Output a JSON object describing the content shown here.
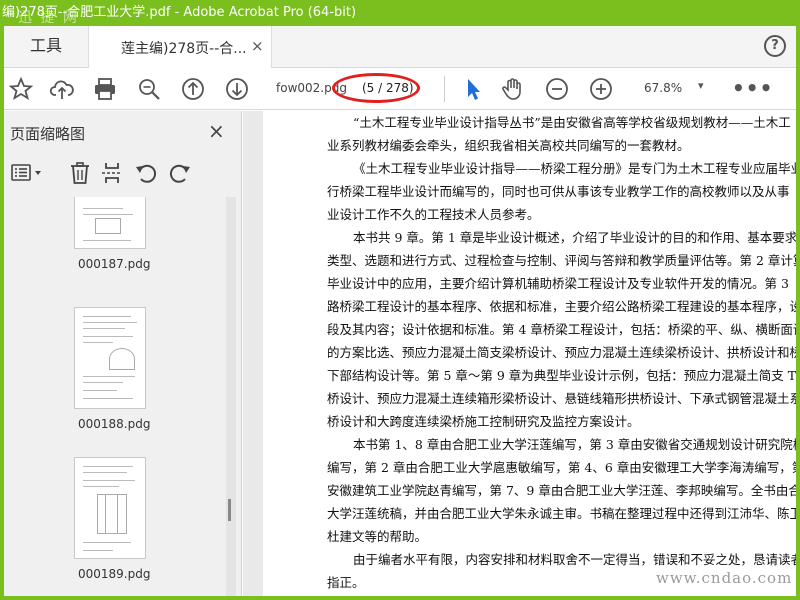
{
  "window": {
    "title": "编)278页--合肥工业大学.pdf - Adobe Acrobat Pro (64-bit)",
    "watermark": "迅 捷 网"
  },
  "tabs": {
    "tools_label": "工具",
    "doc_label": "莲主编)278页--合...",
    "close_symbol": "×",
    "help_symbol": "?"
  },
  "toolbar": {
    "filename": "fow002.pdg",
    "page_indicator": "(5 / 278)",
    "zoom": "67.8%",
    "zoom_caret": "▾",
    "more": "•••",
    "icons": [
      "star-icon",
      "cloud-upload-icon",
      "print-icon",
      "zoom-search-icon",
      "page-up-icon",
      "page-down-icon",
      "select-arrow-icon",
      "hand-icon",
      "zoom-out-icon",
      "zoom-in-icon"
    ],
    "accent": "#1f6fd6"
  },
  "panel": {
    "title": "页面缩略图",
    "close_symbol": "×",
    "tool_icons": [
      "list-options-icon",
      "trash-icon",
      "extract-pages-icon",
      "rotate-left-icon",
      "rotate-right-icon"
    ],
    "thumbnails": [
      {
        "label": "000187.pdg"
      },
      {
        "label": "000188.pdg"
      },
      {
        "label": "000189.pdg"
      }
    ]
  },
  "document": {
    "paragraphs": [
      [
        "“土木工程专业毕业设计指导丛书”是由安徽省高等学校省级规划教材——土木工",
        "业系列教材编委会牵头，组织我省相关高校共同编写的一套教材。"
      ],
      [
        "《土木工程专业毕业设计指导——桥梁工程分册》是专门为土木工程专业应届毕业",
        "行桥梁工程毕业设计而编写的，同时也可供从事该专业教学工作的高校教师以及从事",
        "业设计工作不久的工程技术人员参考。"
      ],
      [
        "本书共 9 章。第 1 章是毕业设计概述，介绍了毕业设计的目的和作用、基本要求",
        "类型、选题和进行方式、过程检查与控制、评阅与答辩和教学质量评估等。第 2 章计算",
        "毕业设计中的应用，主要介绍计算机辅助桥梁工程设计及专业软件开发的情况。第 3",
        "路桥梁工程设计的基本程序、依据和标准，主要介绍公路桥梁工程建设的基本程序，设",
        "段及其内容；设计依据和标准。第 4 章桥梁工程设计，包括：桥梁的平、纵、横断面设计",
        "的方案比选、预应力混凝土简支梁桥设计、预应力混凝土连续梁桥设计、拱桥设计和桥",
        "下部结构设计等。第 5 章～第 9 章为典型毕业设计示例，包括：预应力混凝土简支 T",
        "桥设计、预应力混凝土连续箱形梁桥设计、悬链线箱形拱桥设计、下承式钢管混凝土系",
        "桥设计和大跨度连续梁桥施工控制研究及监控方案设计。"
      ],
      [
        "本书第 1、8 章由合肥工业大学汪莲编写，第 3 章由安徽省交通规划设计研究院梅",
        "编写，第 2 章由合肥工业大学扈惠敏编写，第 4、6 章由安徽理工大学李海涛编写，第 5",
        "安徽建筑工业学院赵青编写，第 7、9 章由合肥工业大学汪莲、李邦映编写。全书由合肥",
        "大学汪莲统稿，并由合肥工业大学朱永诚主审。书稿在整理过程中还得到江沛华、陈卫",
        "杜建文等的帮助。"
      ],
      [
        "由于编者水平有限，内容安排和材料取舍不一定得当，错误和不妥之处，恳请读者",
        "指正。"
      ]
    ]
  },
  "site_watermark": "www.cndao.com",
  "colors": {
    "frame_green": "#7bbf1e",
    "annotation_red": "#e0201c"
  }
}
